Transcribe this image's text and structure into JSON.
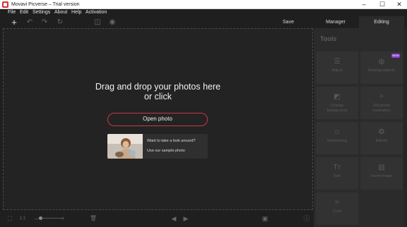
{
  "window": {
    "title": "Movavi Picverse – Trial version",
    "minimize": "–",
    "maximize": "☐",
    "close": "✕"
  },
  "menu": [
    "File",
    "Edit",
    "Settings",
    "About",
    "Help",
    "Activation"
  ],
  "toolbar": {
    "add": "+",
    "undo": "↶",
    "redo": "↷",
    "reset": "↻",
    "compare": "◫",
    "preview": "◉",
    "save_label": "Save",
    "tabs": {
      "manager": "Manager",
      "editing": "Editing"
    }
  },
  "canvas": {
    "drop_title": "Drag and drop your photos here\nor click",
    "open_photo": "Open photo",
    "sample_question": "Want to take a look around?",
    "sample_link": "Use our sample photo"
  },
  "bottom": {
    "fit": "⛶",
    "ratio": "1:1",
    "zoom_minus": "–",
    "zoom_plus": "+",
    "trash": "🗑",
    "prev": "◀",
    "next": "▶",
    "image": "▣",
    "info": "ⓘ"
  },
  "tools": {
    "heading": "Tools",
    "new_badge": "NEW",
    "items": [
      {
        "label": "Adjust",
        "icon": "☰"
      },
      {
        "label": "Erasing objects",
        "icon": "◍"
      },
      {
        "label": "Change\nbackground",
        "icon": "◩"
      },
      {
        "label": "Old photo\nrestoration",
        "icon": "✧"
      },
      {
        "label": "Retouching",
        "icon": "☺"
      },
      {
        "label": "Effects",
        "icon": "❂"
      },
      {
        "label": "Text",
        "icon": "Tт"
      },
      {
        "label": "Insert image",
        "icon": "▨"
      },
      {
        "label": "Crop",
        "icon": "⌗"
      }
    ]
  },
  "colors": {
    "accent": "#c93846",
    "badge": "#8a3fd1",
    "background": "#1f1f1f",
    "panel": "#2b2b2b"
  }
}
